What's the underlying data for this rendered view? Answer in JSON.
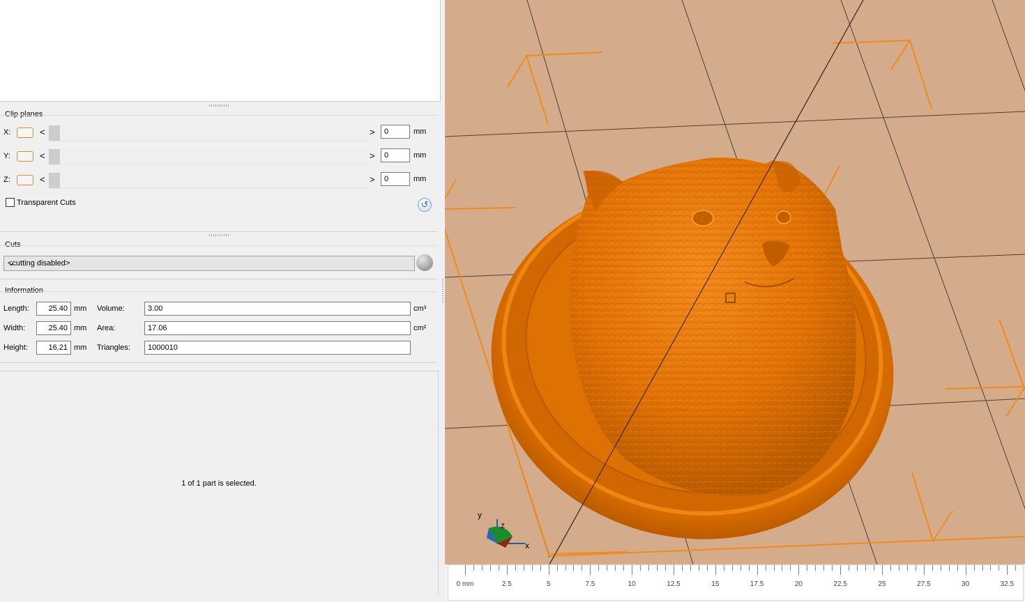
{
  "clip_planes": {
    "title": "Clip planes",
    "rows": [
      {
        "axis": "X:",
        "value": "0",
        "unit": "mm"
      },
      {
        "axis": "Y:",
        "value": "0",
        "unit": "mm"
      },
      {
        "axis": "Z:",
        "value": "0",
        "unit": "mm"
      }
    ],
    "prev_glyph": "<",
    "next_glyph": ">",
    "transparent_label": "Transparent Cuts",
    "reset_icon": "reset-icon"
  },
  "cuts": {
    "title": "Cuts",
    "selected": "<cutting disabled>",
    "chevron": "⌄"
  },
  "information": {
    "title": "Information",
    "length_label": "Length:",
    "length_value": "25.40",
    "length_unit": "mm",
    "width_label": "Width:",
    "width_value": "25.40",
    "width_unit": "mm",
    "height_label": "Height:",
    "height_value": "16.21",
    "height_unit": "mm",
    "volume_label": "Volume:",
    "volume_value": "3.00",
    "volume_unit": "cm³",
    "area_label": "Area:",
    "area_value": "17.06",
    "area_unit": "cm²",
    "triangles_label": "Triangles:",
    "triangles_value": "1000010"
  },
  "status": "1 of 1 part is selected.",
  "axis_triad": {
    "x": "x",
    "y": "y",
    "z": "z"
  },
  "ruler": {
    "labels": [
      "0 mm",
      "2.5",
      "5",
      "7.5",
      "10",
      "12.5",
      "15",
      "17.5",
      "20",
      "22.5",
      "25",
      "27.5",
      "30",
      "32.5"
    ]
  },
  "colors": {
    "model": "#ef7d0a",
    "plate": "#d4ac8c",
    "accent": "#f08a1c"
  }
}
